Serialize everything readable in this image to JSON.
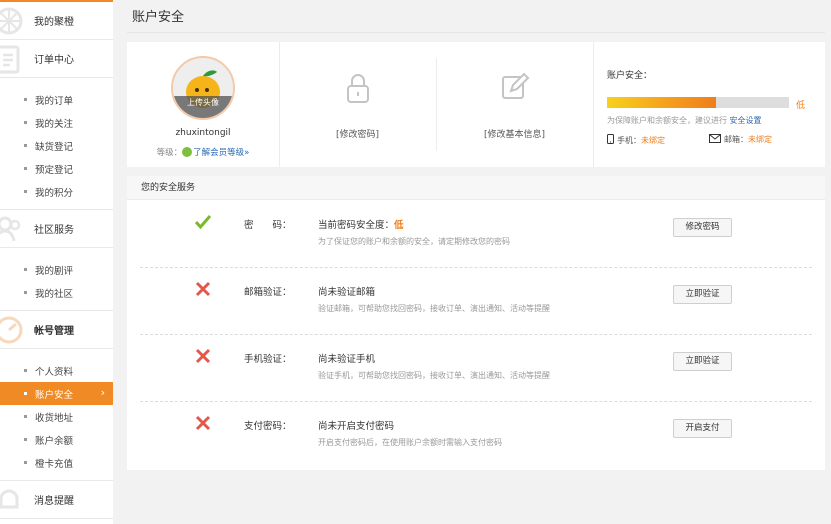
{
  "sidebar": {
    "my_orange": "我的聚橙",
    "order_center": "订单中心",
    "order_items": [
      "我的订单",
      "我的关注",
      "缺货登记",
      "预定登记",
      "我的积分"
    ],
    "community": "社区服务",
    "community_items": [
      "我的剧评",
      "我的社区"
    ],
    "account": "帐号管理",
    "account_items": [
      "个人资料",
      "账户安全",
      "收货地址",
      "账户余额",
      "橙卡充值"
    ],
    "messages": "消息提醒"
  },
  "page": {
    "title": "账户安全"
  },
  "profile": {
    "avatar_caption": "上传头像",
    "username": "zhuxintongil",
    "level_label": "等级：",
    "level_link": "了解会员等级»"
  },
  "tools": {
    "change_password": "[修改密码]",
    "edit_info": "[修改基本信息]"
  },
  "security": {
    "title": "账户安全：",
    "level": "低",
    "level_fraction": 0.6,
    "tip": "为保障账户和余额安全，建议进行",
    "tip_link": "安全设置",
    "phone_label": "手机：",
    "phone_status": "未绑定",
    "email_label": "邮箱：",
    "email_status": "未绑定",
    "accent": "#ef7e1c"
  },
  "services": {
    "heading": "您的安全服务",
    "rows": [
      {
        "icon": "check-icon",
        "label": "密　　码：",
        "status_prefix": "当前密码安全度：",
        "status_level": "低",
        "desc": "为了保证您的账户和余额的安全，请定期修改您的密码",
        "button": "修改密码"
      },
      {
        "icon": "cross-icon",
        "label": "邮箱验证：",
        "status": "尚未验证邮箱",
        "desc": "验证邮箱，可帮助您找回密码，接收订单、演出通知、活动等提醒",
        "button": "立即验证"
      },
      {
        "icon": "cross-icon",
        "label": "手机验证：",
        "status": "尚未验证手机",
        "desc": "验证手机，可帮助您找回密码，接收订单、演出通知、活动等提醒",
        "button": "立即验证"
      },
      {
        "icon": "cross-icon",
        "label": "支付密码：",
        "status": "尚未开启支付密码",
        "desc": "开启支付密码后，在使用账户余额时需输入支付密码",
        "button": "开启支付"
      }
    ]
  }
}
